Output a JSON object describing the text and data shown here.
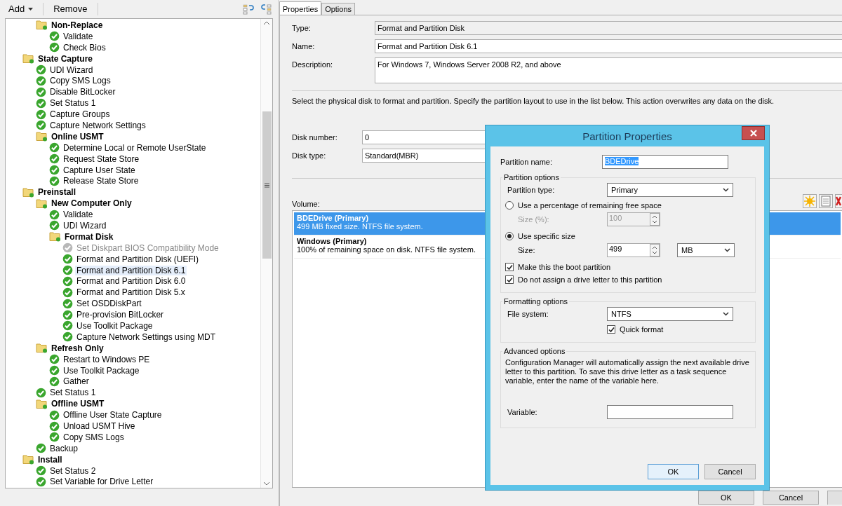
{
  "left_pane": {
    "toolbar": {
      "add_menu": "Add",
      "remove_button": "Remove"
    },
    "tree": {
      "continued_children": [
        {
          "label": "Non-Replace",
          "kind": "group",
          "selected": false,
          "children": [
            {
              "label": "Validate",
              "kind": "step",
              "disabled": false,
              "selected": false
            },
            {
              "label": "Check Bios",
              "kind": "step",
              "disabled": false,
              "selected": false
            }
          ]
        }
      ],
      "items": [
        {
          "label": "State Capture",
          "kind": "group",
          "selected": false,
          "children": [
            {
              "label": "UDI Wizard",
              "kind": "step",
              "disabled": false,
              "selected": false
            },
            {
              "label": "Copy SMS Logs",
              "kind": "step",
              "disabled": false,
              "selected": false
            },
            {
              "label": "Disable BitLocker",
              "kind": "step",
              "disabled": false,
              "selected": false
            },
            {
              "label": "Set Status 1",
              "kind": "step",
              "disabled": false,
              "selected": false
            },
            {
              "label": "Capture Groups",
              "kind": "step",
              "disabled": false,
              "selected": false
            },
            {
              "label": "Capture Network Settings",
              "kind": "step",
              "disabled": false,
              "selected": false
            },
            {
              "label": "Online USMT",
              "kind": "group",
              "selected": false,
              "children": [
                {
                  "label": "Determine Local or Remote UserState",
                  "kind": "step",
                  "disabled": false,
                  "selected": false
                },
                {
                  "label": "Request State Store",
                  "kind": "step",
                  "disabled": false,
                  "selected": false
                },
                {
                  "label": "Capture User State",
                  "kind": "step",
                  "disabled": false,
                  "selected": false
                },
                {
                  "label": "Release State Store",
                  "kind": "step",
                  "disabled": false,
                  "selected": false
                }
              ]
            }
          ]
        },
        {
          "label": "Preinstall",
          "kind": "group",
          "selected": false,
          "children": [
            {
              "label": "New Computer Only",
              "kind": "group",
              "selected": false,
              "children": [
                {
                  "label": "Validate",
                  "kind": "step",
                  "disabled": false,
                  "selected": false
                },
                {
                  "label": "UDI Wizard",
                  "kind": "step",
                  "disabled": false,
                  "selected": false
                },
                {
                  "label": "Format Disk",
                  "kind": "group",
                  "selected": false,
                  "children": [
                    {
                      "label": "Set Diskpart BIOS Compatibility Mode",
                      "kind": "step",
                      "disabled": true,
                      "selected": false
                    },
                    {
                      "label": "Format and Partition Disk (UEFI)",
                      "kind": "step",
                      "disabled": false,
                      "selected": false
                    },
                    {
                      "label": "Format and Partition Disk 6.1",
                      "kind": "step",
                      "disabled": false,
                      "selected": true
                    },
                    {
                      "label": "Format and Partition Disk 6.0",
                      "kind": "step",
                      "disabled": false,
                      "selected": false
                    },
                    {
                      "label": "Format and Partition Disk 5.x",
                      "kind": "step",
                      "disabled": false,
                      "selected": false
                    },
                    {
                      "label": "Set OSDDiskPart",
                      "kind": "step",
                      "disabled": false,
                      "selected": false
                    },
                    {
                      "label": "Pre-provision BitLocker",
                      "kind": "step",
                      "disabled": false,
                      "selected": false
                    },
                    {
                      "label": "Use Toolkit Package",
                      "kind": "step",
                      "disabled": false,
                      "selected": false
                    },
                    {
                      "label": "Capture Network Settings using MDT",
                      "kind": "step",
                      "disabled": false,
                      "selected": false
                    }
                  ]
                }
              ]
            },
            {
              "label": "Refresh Only",
              "kind": "group",
              "selected": false,
              "children": [
                {
                  "label": "Restart to Windows PE",
                  "kind": "step",
                  "disabled": false,
                  "selected": false
                },
                {
                  "label": "Use Toolkit Package",
                  "kind": "step",
                  "disabled": false,
                  "selected": false
                },
                {
                  "label": "Gather",
                  "kind": "step",
                  "disabled": false,
                  "selected": false
                }
              ]
            },
            {
              "label": "Set Status 1",
              "kind": "step",
              "disabled": false,
              "selected": false
            },
            {
              "label": "Offline USMT",
              "kind": "group",
              "selected": false,
              "children": [
                {
                  "label": "Offline User State Capture",
                  "kind": "step",
                  "disabled": false,
                  "selected": false
                },
                {
                  "label": "Unload USMT Hive",
                  "kind": "step",
                  "disabled": false,
                  "selected": false
                },
                {
                  "label": "Copy SMS Logs",
                  "kind": "step",
                  "disabled": false,
                  "selected": false
                }
              ]
            },
            {
              "label": "Backup",
              "kind": "step",
              "disabled": false,
              "selected": false
            }
          ]
        },
        {
          "label": "Install",
          "kind": "group",
          "selected": false,
          "children": [
            {
              "label": "Set Status 2",
              "kind": "step",
              "disabled": false,
              "selected": false
            },
            {
              "label": "Set Variable for Drive Letter",
              "kind": "step",
              "disabled": false,
              "selected": false
            }
          ]
        }
      ]
    }
  },
  "right_pane": {
    "tabs": [
      {
        "label": "Properties",
        "selected": true
      },
      {
        "label": "Options",
        "selected": false
      }
    ],
    "fields": [
      {
        "label": "Type:",
        "value": "Format and Partition Disk",
        "kind": "readonly"
      },
      {
        "label": "Name:",
        "value": "Format and Partition Disk 6.1",
        "kind": "text"
      },
      {
        "label": "Description:",
        "value": "For Windows 7, Windows Server 2008 R2, and above",
        "kind": "multiline"
      }
    ],
    "instruction": "Select the physical disk to format and partition. Specify the partition layout to use in the list below. This action overwrites any data on the disk.",
    "disk_fields": [
      {
        "label": "Disk number:",
        "value": "0"
      },
      {
        "label": "Disk type:",
        "value": "Standard(MBR)"
      }
    ],
    "volume": {
      "label": "Volume:",
      "items": [
        {
          "title": "BDEDrive (Primary)",
          "detail": "499 MB fixed size. NTFS file system.",
          "selected": true
        },
        {
          "title": "Windows (Primary)",
          "detail": "100% of remaining space on disk. NTFS file system.",
          "selected": false
        }
      ]
    },
    "footer_buttons": [
      "OK",
      "Cancel"
    ]
  },
  "dialog": {
    "title": "Partition Properties",
    "partition_name": {
      "label": "Partition name:",
      "value": "BDEDrive"
    },
    "partition_options": {
      "title": "Partition options",
      "partition_type": {
        "label": "Partition type:",
        "value": "Primary"
      },
      "size_modes": [
        {
          "label": "Use a percentage of remaining free space",
          "selected": false,
          "size_label": "Size (%):",
          "size_value": "100"
        },
        {
          "label": "Use specific size",
          "selected": true,
          "size_label": "Size:",
          "size_value": "499",
          "unit": "MB"
        }
      ],
      "checkboxes": [
        {
          "label": "Make this the boot partition",
          "checked": true
        },
        {
          "label": "Do not assign a drive letter to this partition",
          "checked": true
        }
      ]
    },
    "formatting_options": {
      "title": "Formatting options",
      "file_system": {
        "label": "File system:",
        "value": "NTFS"
      },
      "quick_format": {
        "label": "Quick format",
        "checked": true
      }
    },
    "advanced_options": {
      "title": "Advanced options",
      "text": "Configuration Manager will automatically assign the next available drive letter to this partition. To save this drive letter as a task sequence variable, enter the name of the variable here.",
      "variable": {
        "label": "Variable:"
      }
    },
    "buttons": [
      "OK",
      "Cancel"
    ]
  }
}
